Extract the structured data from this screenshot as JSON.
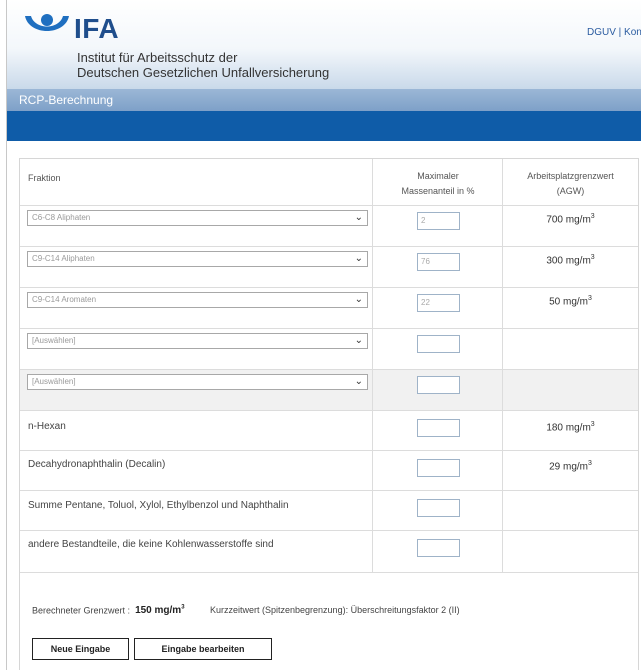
{
  "header": {
    "logo_text": "IFA",
    "institute_line1": "Institut für Arbeitsschutz der",
    "institute_line2": "Deutschen Gesetzlichen Unfallversicherung",
    "top_links": "DGUV | Kontakt"
  },
  "subbar": {
    "title": "RCP-Berechnung"
  },
  "table": {
    "col_fraktion": "Fraktion",
    "col_mass_line1": "Maximaler",
    "col_mass_line2": "Massenanteil in %",
    "col_agw_line1": "Arbeitsplatzgrenzwert",
    "col_agw_line2": "(AGW)",
    "select_rows": [
      {
        "selected": "C6-C8 Aliphaten",
        "mass": "2",
        "agw": "700 mg/m",
        "agw_exp": "3"
      },
      {
        "selected": "C9-C14 Aliphaten",
        "mass": "76",
        "agw": "300 mg/m",
        "agw_exp": "3"
      },
      {
        "selected": "C9-C14 Aromaten",
        "mass": "22",
        "agw": "50 mg/m",
        "agw_exp": "3"
      },
      {
        "selected": "[Auswählen]",
        "mass": "",
        "agw": "",
        "agw_exp": ""
      },
      {
        "selected": "[Auswählen]",
        "mass": "",
        "agw": "",
        "agw_exp": ""
      }
    ],
    "fixed_rows": [
      {
        "label": "n-Hexan",
        "mass": "",
        "agw": "180 mg/m",
        "agw_exp": "3"
      },
      {
        "label": "Decahydronaphthalin (Decalin)",
        "mass": "",
        "agw": "29 mg/m",
        "agw_exp": "3"
      },
      {
        "label": "Summe Pentane, Toluol, Xylol, Ethylbenzol und Naphthalin",
        "mass": "",
        "agw": "",
        "agw_exp": ""
      },
      {
        "label": "andere Bestandteile, die keine Kohlenwasserstoffe sind",
        "mass": "",
        "agw": "",
        "agw_exp": ""
      }
    ]
  },
  "result": {
    "label": "Berechneter Grenzwert :",
    "value": "150 mg/m",
    "value_exp": "3",
    "kurzzeit": "Kurzzeitwert (Spitzenbegrenzung): Überschreitungsfaktor 2 (II)"
  },
  "buttons": {
    "new_label": "Neue Eingabe",
    "edit_label": "Eingabe bearbeiten"
  },
  "colors": {
    "brand_blue": "#1f4e8c",
    "bar_blue": "#0f5ca8",
    "subbar": "#8aaad0"
  }
}
